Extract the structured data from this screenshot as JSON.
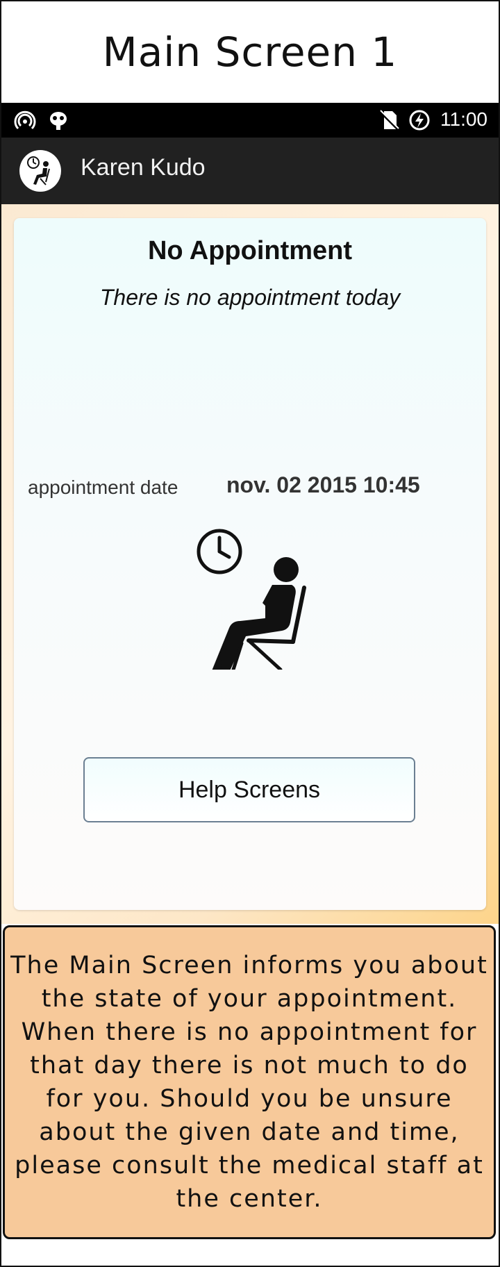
{
  "screen_title": "Main Screen 1",
  "status_bar": {
    "time": "11:00",
    "left_icons": [
      "hotspot-icon",
      "cyanogen-bug-icon"
    ],
    "right_icons": [
      "no-sim-icon",
      "battery-charging-icon"
    ]
  },
  "app_bar": {
    "title": "Karen Kudo",
    "logo_icon": "waiting-person-clock-icon"
  },
  "card": {
    "heading": "No Appointment",
    "subheading": "There is no appointment today",
    "date_label": "appointment date",
    "date_value": "nov. 02 2015 10:45",
    "illustration": "waiting-person-clock-icon",
    "help_button_label": "Help Screens"
  },
  "note": {
    "text": "The Main Screen informs you about the state of your appointment. When there is no appointment for that day there is not much to do for you. Should you be unsure about the given date and time, please consult the medical staff at the center."
  },
  "colors": {
    "status_bar": "#000000",
    "app_bar": "#212121",
    "note_background": "#f7c99a",
    "button_border": "#6b7f92"
  }
}
